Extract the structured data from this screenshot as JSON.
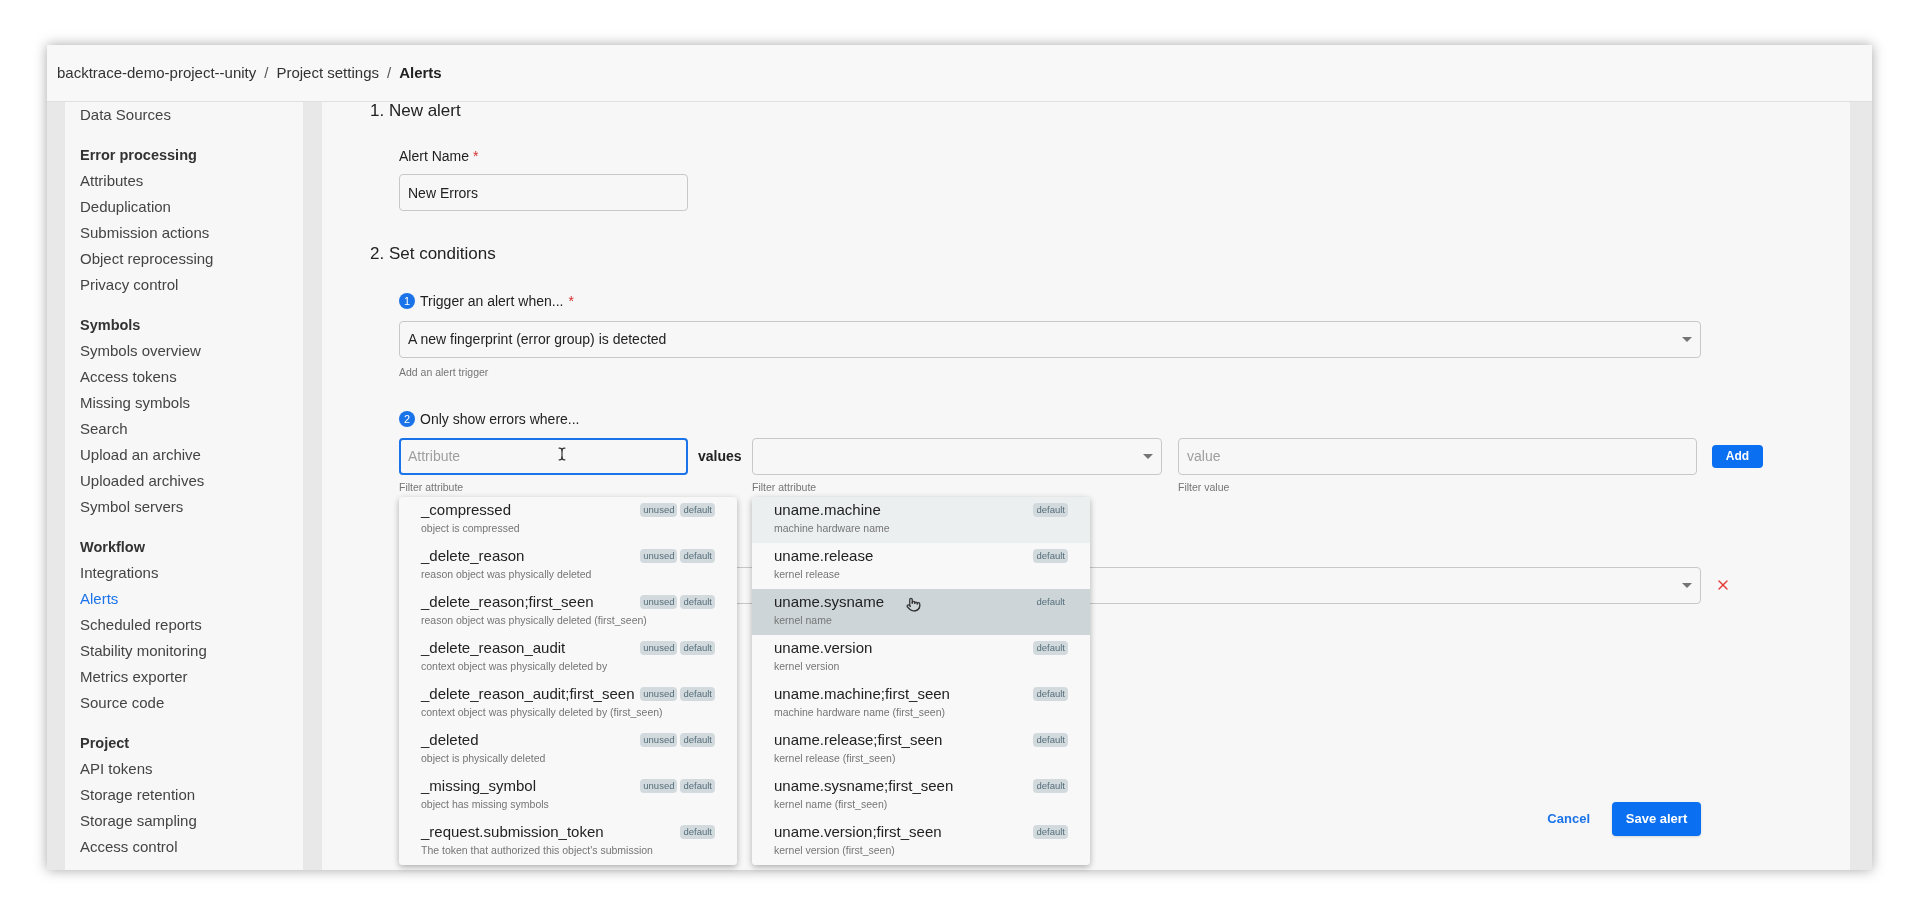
{
  "breadcrumb_separator": "/",
  "breadcrumb": [
    {
      "label": "backtrace-demo-project--unity",
      "current": false
    },
    {
      "label": "Project settings",
      "current": false
    },
    {
      "label": "Alerts",
      "current": true
    }
  ],
  "sidebar": {
    "sections": [
      {
        "items": [
          {
            "label": "Data Sources",
            "selected": false
          }
        ]
      },
      {
        "heading": "Error processing",
        "items": [
          {
            "label": "Attributes",
            "selected": false
          },
          {
            "label": "Deduplication",
            "selected": false
          },
          {
            "label": "Submission actions",
            "selected": false
          },
          {
            "label": "Object reprocessing",
            "selected": false
          },
          {
            "label": "Privacy control",
            "selected": false
          }
        ]
      },
      {
        "heading": "Symbols",
        "items": [
          {
            "label": "Symbols overview",
            "selected": false
          },
          {
            "label": "Access tokens",
            "selected": false
          },
          {
            "label": "Missing symbols",
            "selected": false
          },
          {
            "label": "Search",
            "selected": false
          },
          {
            "label": "Upload an archive",
            "selected": false
          },
          {
            "label": "Uploaded archives",
            "selected": false
          },
          {
            "label": "Symbol servers",
            "selected": false
          }
        ]
      },
      {
        "heading": "Workflow",
        "items": [
          {
            "label": "Integrations",
            "selected": false
          },
          {
            "label": "Alerts",
            "selected": true
          },
          {
            "label": "Scheduled reports",
            "selected": false
          },
          {
            "label": "Stability monitoring",
            "selected": false
          },
          {
            "label": "Metrics exporter",
            "selected": false
          },
          {
            "label": "Source code",
            "selected": false
          }
        ]
      },
      {
        "heading": "Project",
        "items": [
          {
            "label": "API tokens",
            "selected": false
          },
          {
            "label": "Storage retention",
            "selected": false
          },
          {
            "label": "Storage sampling",
            "selected": false
          },
          {
            "label": "Access control",
            "selected": false
          }
        ]
      }
    ]
  },
  "form": {
    "step1_title": "1. New alert",
    "alert_name": {
      "label": "Alert Name",
      "required_mark": "*",
      "value": "New Errors"
    },
    "step2_title": "2. Set conditions",
    "trigger": {
      "number": "1",
      "label": "Trigger an alert when...",
      "required_mark": "*",
      "value": "A new fingerprint (error group) is detected",
      "helper": "Add an alert trigger"
    },
    "filter": {
      "number": "2",
      "label": "Only show errors where...",
      "attribute_field": {
        "placeholder": "Attribute",
        "helper": "Filter attribute",
        "focused": true
      },
      "values_label": "values",
      "values_select": {
        "helper": "Filter attribute"
      },
      "value_field": {
        "placeholder": "value",
        "helper": "Filter value"
      },
      "add_button": "Add"
    },
    "cancel_button": "Cancel",
    "save_button": "Save alert"
  },
  "attribute_menu": {
    "items": [
      {
        "name": "_compressed",
        "description": "object is compressed",
        "tags": [
          "unused",
          "default"
        ]
      },
      {
        "name": "_delete_reason",
        "description": "reason object was physically deleted",
        "tags": [
          "unused",
          "default"
        ]
      },
      {
        "name": "_delete_reason;first_seen",
        "description": "reason object was physically deleted (first_seen)",
        "tags": [
          "unused",
          "default"
        ]
      },
      {
        "name": "_delete_reason_audit",
        "description": "context object was physically deleted by",
        "tags": [
          "unused",
          "default"
        ]
      },
      {
        "name": "_delete_reason_audit;first_seen",
        "description": "context object was physically deleted by (first_seen)",
        "tags": [
          "unused",
          "default"
        ]
      },
      {
        "name": "_deleted",
        "description": "object is physically deleted",
        "tags": [
          "unused",
          "default"
        ]
      },
      {
        "name": "_missing_symbol",
        "description": "object has missing symbols",
        "tags": [
          "unused",
          "default"
        ]
      },
      {
        "name": "_request.submission_token",
        "description": "The token that authorized this object's submission",
        "tags": [
          "default"
        ]
      }
    ]
  },
  "value_menu": {
    "items": [
      {
        "name": "uname.machine",
        "description": "machine hardware name",
        "tags": [
          "default"
        ],
        "focused": true,
        "hovered": false
      },
      {
        "name": "uname.release",
        "description": "kernel release",
        "tags": [
          "default"
        ],
        "focused": false,
        "hovered": false
      },
      {
        "name": "uname.sysname",
        "description": "kernel name",
        "tags": [
          "default"
        ],
        "focused": false,
        "hovered": true
      },
      {
        "name": "uname.version",
        "description": "kernel version",
        "tags": [
          "default"
        ],
        "focused": false,
        "hovered": false
      },
      {
        "name": "uname.machine;first_seen",
        "description": "machine hardware name (first_seen)",
        "tags": [
          "default"
        ],
        "focused": false,
        "hovered": false
      },
      {
        "name": "uname.release;first_seen",
        "description": "kernel release (first_seen)",
        "tags": [
          "default"
        ],
        "focused": false,
        "hovered": false
      },
      {
        "name": "uname.sysname;first_seen",
        "description": "kernel name (first_seen)",
        "tags": [
          "default"
        ],
        "focused": false,
        "hovered": false
      },
      {
        "name": "uname.version;first_seen",
        "description": "kernel version (first_seen)",
        "tags": [
          "default"
        ],
        "focused": false,
        "hovered": false
      }
    ]
  }
}
